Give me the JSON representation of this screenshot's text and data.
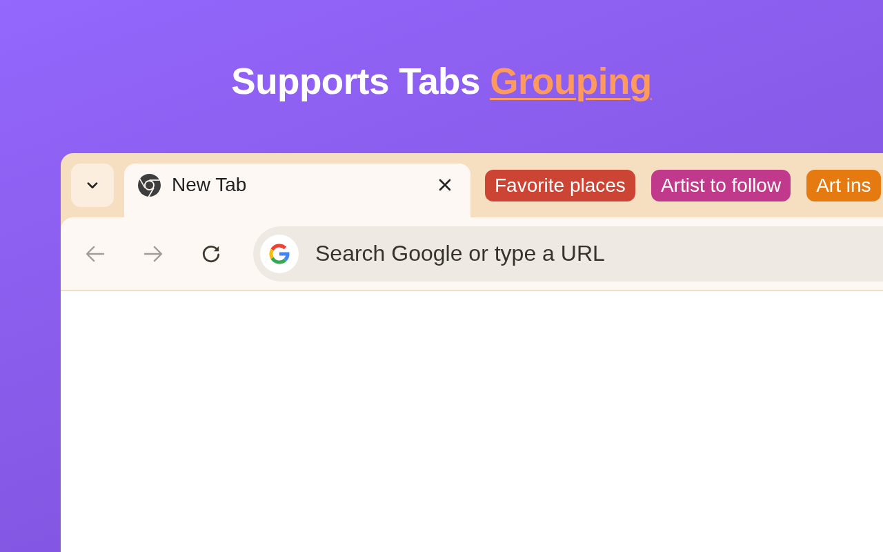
{
  "headline": {
    "parts": [
      {
        "text": "Supports Tabs ",
        "emphasis": false
      },
      {
        "text": "Grouping",
        "emphasis": true
      }
    ]
  },
  "browser": {
    "tabs": [
      {
        "title": "New Tab",
        "selected": true
      }
    ],
    "tab_groups": [
      {
        "label": "Favorite places",
        "color": "#cc4433"
      },
      {
        "label": "Artist to follow",
        "color": "#c1398b"
      },
      {
        "label": "Art ins",
        "color": "#e57a10"
      }
    ],
    "nav_buttons": [
      {
        "kind": "back",
        "disabled": true
      },
      {
        "kind": "forward",
        "disabled": true
      },
      {
        "kind": "reload",
        "disabled": false
      }
    ],
    "omnibox": {
      "placeholder": "Search Google or type a URL"
    }
  }
}
